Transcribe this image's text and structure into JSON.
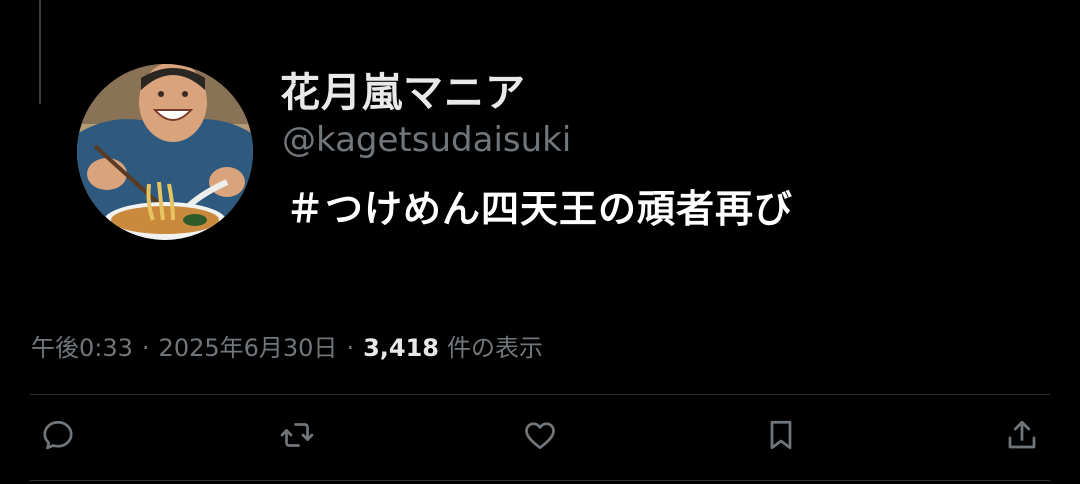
{
  "theme": {
    "background": "#000000",
    "primary_text": "#e7e9ea",
    "secondary_text": "#71767b",
    "divider": "#2f3336"
  },
  "author": {
    "display_name": "花月嵐マニア",
    "handle": "@kagetsudaisuki"
  },
  "tweet": {
    "text": "＃つけめん四天王の頑者再び"
  },
  "meta": {
    "time": "午後0:33",
    "separator": "·",
    "date": "2025年6月30日",
    "views_count": "3,418",
    "views_label": "件の表示"
  },
  "actions": [
    {
      "name": "reply-button",
      "icon": "reply-icon"
    },
    {
      "name": "retweet-button",
      "icon": "retweet-icon"
    },
    {
      "name": "like-button",
      "icon": "heart-icon"
    },
    {
      "name": "bookmark-button",
      "icon": "bookmark-icon"
    },
    {
      "name": "share-button",
      "icon": "share-icon"
    }
  ]
}
